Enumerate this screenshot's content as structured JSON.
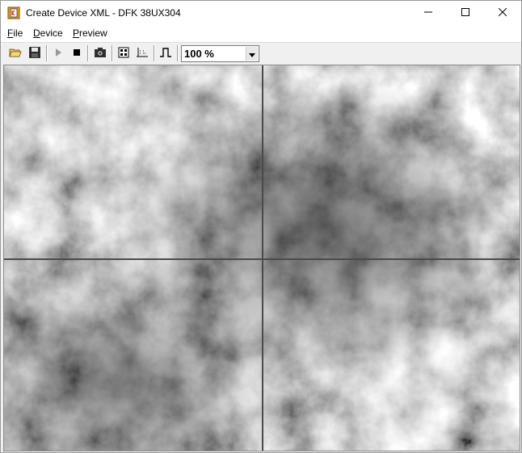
{
  "window": {
    "title": "Create Device XML - DFK 38UX304"
  },
  "icons": {
    "app": "device-app-icon",
    "minimize": "minimize-icon",
    "maximize": "maximize-icon",
    "close": "close-icon",
    "open": "open-folder-icon",
    "save": "save-icon",
    "play": "play-icon",
    "stop": "stop-icon",
    "snapshot": "camera-icon",
    "properties": "properties-icon",
    "format": "format-icon",
    "trigger": "trigger-icon",
    "dropdown": "chevron-down-icon"
  },
  "menu": {
    "file": "File",
    "device": "Device",
    "preview": "Preview"
  },
  "toolbar": {
    "zoom_value": "100 %"
  },
  "colors": {
    "window_bg": "#f0f0f0",
    "titlebar_bg": "#ffffff",
    "crosshair": "#4a4a4a"
  }
}
